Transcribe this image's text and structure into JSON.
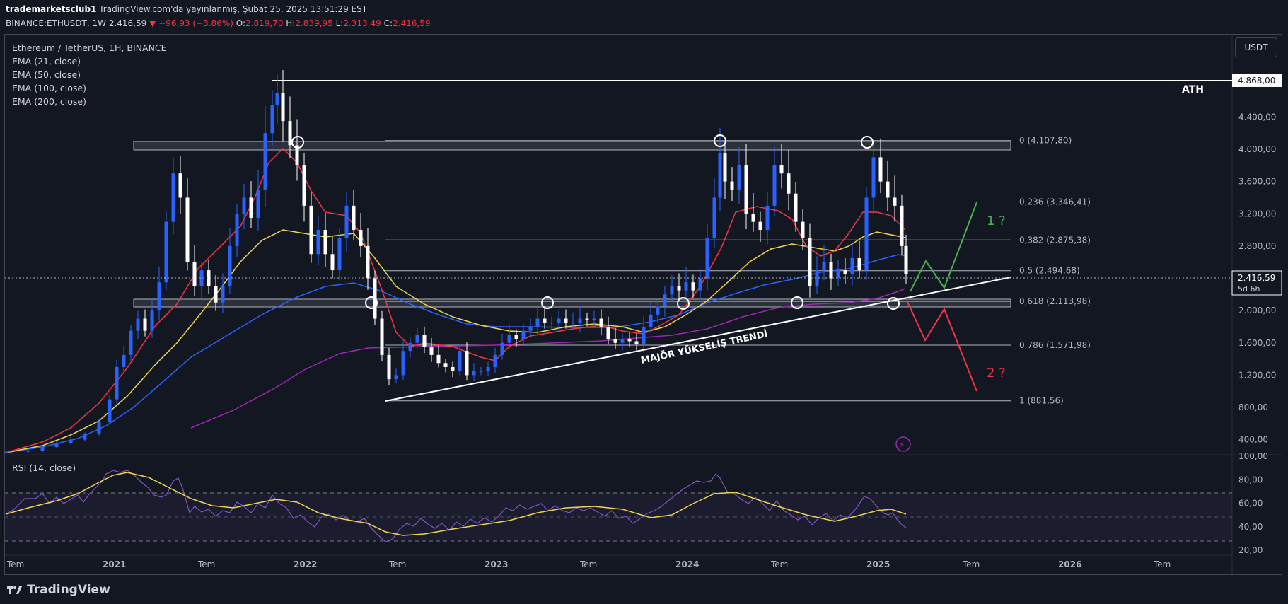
{
  "header": {
    "author": "trademarketsclub1",
    "published": "TradingView.com'da yayınlanmış, Şubat 25, 2025 13:51:29 EST",
    "symbol_line": "BINANCE:ETHUSDT, 1W",
    "last": "2.416,59",
    "change": "−96,93 (−3.86%)",
    "o_label": "O:",
    "o_val": "2.819,70",
    "h_label": "H:",
    "h_val": "2.839,95",
    "l_label": "L:",
    "l_val": "2.313,49",
    "c_label": "C:",
    "c_val": "2.416,59"
  },
  "legend": {
    "title": "Ethereum / TetherUS, 1H, BINANCE",
    "ema21": "EMA (21, close)",
    "ema50": "EMA (50, close)",
    "ema100": "EMA (100, close)",
    "ema200": "EMA (200, close)",
    "rsi": "RSI (14, close)"
  },
  "currency_button": "USDT",
  "price_axis": {
    "ticks": [
      "4.400,00",
      "4.000,00",
      "3.600,00",
      "3.200,00",
      "2.800,00",
      "2.400,00",
      "2.000,00",
      "1.600,00",
      "1.200,00",
      "800,00",
      "400,00"
    ],
    "ath_label": "4.868,00",
    "last_label": "2.416,59",
    "countdown": "5d 6h"
  },
  "rsi_axis": {
    "ticks": [
      "100,00",
      "80,00",
      "60,00",
      "40,00",
      "20,00"
    ]
  },
  "time_axis": [
    "Tem",
    "2021",
    "Tem",
    "2022",
    "Tem",
    "2023",
    "Tem",
    "2024",
    "Tem",
    "2025",
    "Tem",
    "2026",
    "Tem"
  ],
  "annotations": {
    "ath": "ATH",
    "trend": "MAJÖR YÜKSELİŞ TRENDİ",
    "scenario1": "1 ?",
    "scenario2": "2 ?"
  },
  "fib_levels": [
    {
      "label": "0 (4.107,80)",
      "price": 4107.8
    },
    {
      "label": "0,236 (3.346,41)",
      "price": 3346.41
    },
    {
      "label": "0,382 (2.875,38)",
      "price": 2875.38
    },
    {
      "label": "0,5 (2.494,68)",
      "price": 2494.68
    },
    {
      "label": "0,618 (2.113,98)",
      "price": 2113.98
    },
    {
      "label": "0,786 (1.571,98)",
      "price": 1571.98
    },
    {
      "label": "1 (881,56)",
      "price": 881.56
    }
  ],
  "colors": {
    "background": "#131722",
    "bull": "#2962ff",
    "bear": "#ffffff",
    "ema21": "#f23645",
    "ema50": "#f0d74a",
    "ema100": "#2962ff",
    "ema200": "#9c27b0",
    "rsi": "#7e57c2",
    "rsi_ma": "#f0d74a",
    "scenario_up": "#4caf50",
    "scenario_down": "#f23645"
  },
  "footer": {
    "brand": "TradingView"
  },
  "chart_data": {
    "type": "candlestick",
    "symbol": "ETHUSDT",
    "interval": "1W",
    "price_axis_range": [
      400,
      4800
    ],
    "weekly_closes_approx": [
      {
        "date": "2020-07",
        "close": 240
      },
      {
        "date": "2021-01",
        "close": 1300
      },
      {
        "date": "2021-05",
        "close": 3900
      },
      {
        "date": "2021-07",
        "close": 2000
      },
      {
        "date": "2021-11",
        "close": 4700
      },
      {
        "date": "2022-06",
        "close": 1000
      },
      {
        "date": "2023-07",
        "close": 1900
      },
      {
        "date": "2024-03",
        "close": 3900
      },
      {
        "date": "2024-08",
        "close": 2300
      },
      {
        "date": "2024-12",
        "close": 4000
      },
      {
        "date": "2025-02",
        "close": 2416.59
      }
    ],
    "ath": 4868,
    "rsi_range": [
      20,
      100
    ],
    "rsi_bands": [
      30,
      50,
      70
    ]
  }
}
